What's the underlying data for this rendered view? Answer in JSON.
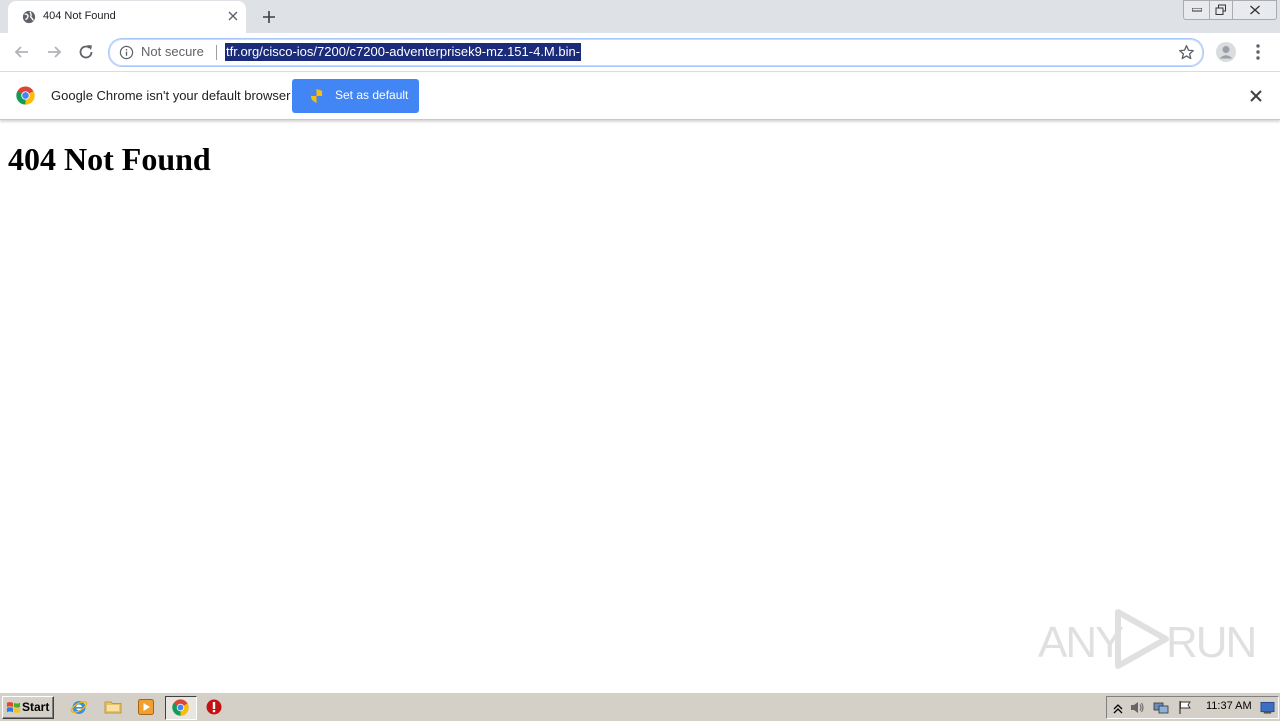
{
  "browser": {
    "tab": {
      "title": "404 Not Found"
    },
    "omnibox": {
      "security_label": "Not secure",
      "url": "tfr.org/cisco-ios/7200/c7200-adventerprisek9-mz.151-4.M.bin-"
    },
    "infobar": {
      "message": "Google Chrome isn't your default browser",
      "button_label": "Set as default"
    }
  },
  "page": {
    "heading": "404 Not Found"
  },
  "watermark": {
    "left": "ANY",
    "right": "RUN"
  },
  "taskbar": {
    "start_label": "Start",
    "clock": "11:37 AM",
    "pinned": [
      "internet-explorer-icon",
      "folder-icon",
      "media-player-icon",
      "chrome-icon",
      "stop-icon"
    ]
  },
  "colors": {
    "accent": "#4285f4",
    "selection": "#1a2b7a",
    "tabstrip": "#dee1e6"
  }
}
